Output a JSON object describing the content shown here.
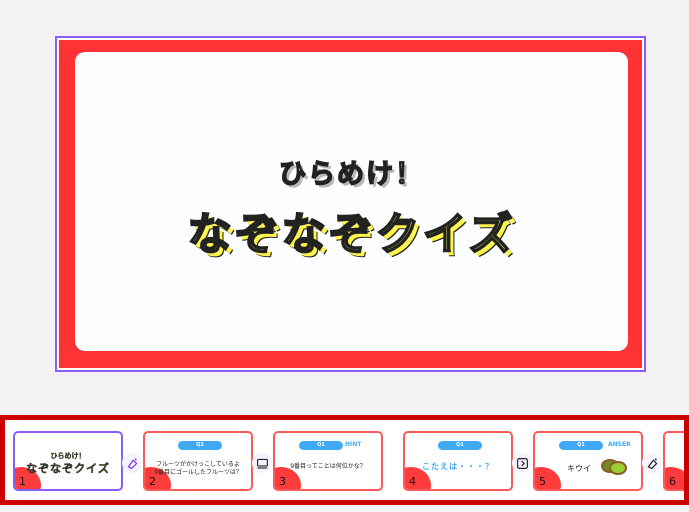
{
  "slide": {
    "subtitle": "ひらめけ！",
    "title": "なぞなぞクイズ"
  },
  "filmstrip": {
    "thumbs": [
      {
        "number": "1",
        "subtitle": "ひらめけ！",
        "title": "なぞなぞクイズ"
      },
      {
        "number": "2",
        "pill": "Q1",
        "line1": "フルーツがかけっこしているよ",
        "line2": "9番目にゴールしたフルーツは？"
      },
      {
        "number": "3",
        "pill": "Q1",
        "hint": "HINT",
        "line1": "9番目ってことは何位かな？"
      },
      {
        "number": "4",
        "pill": "Q1",
        "text": "こたえは・・・？"
      },
      {
        "number": "5",
        "pill": "Q1",
        "answer_label": "ANSER",
        "answer": "キウイ"
      },
      {
        "number": "6"
      }
    ]
  },
  "colors": {
    "slide_bg": "#ff3333",
    "title": "#fff34d",
    "selection": "#8b5cf6",
    "accent": "#3fa9f5",
    "strip_border": "#cc0000"
  }
}
